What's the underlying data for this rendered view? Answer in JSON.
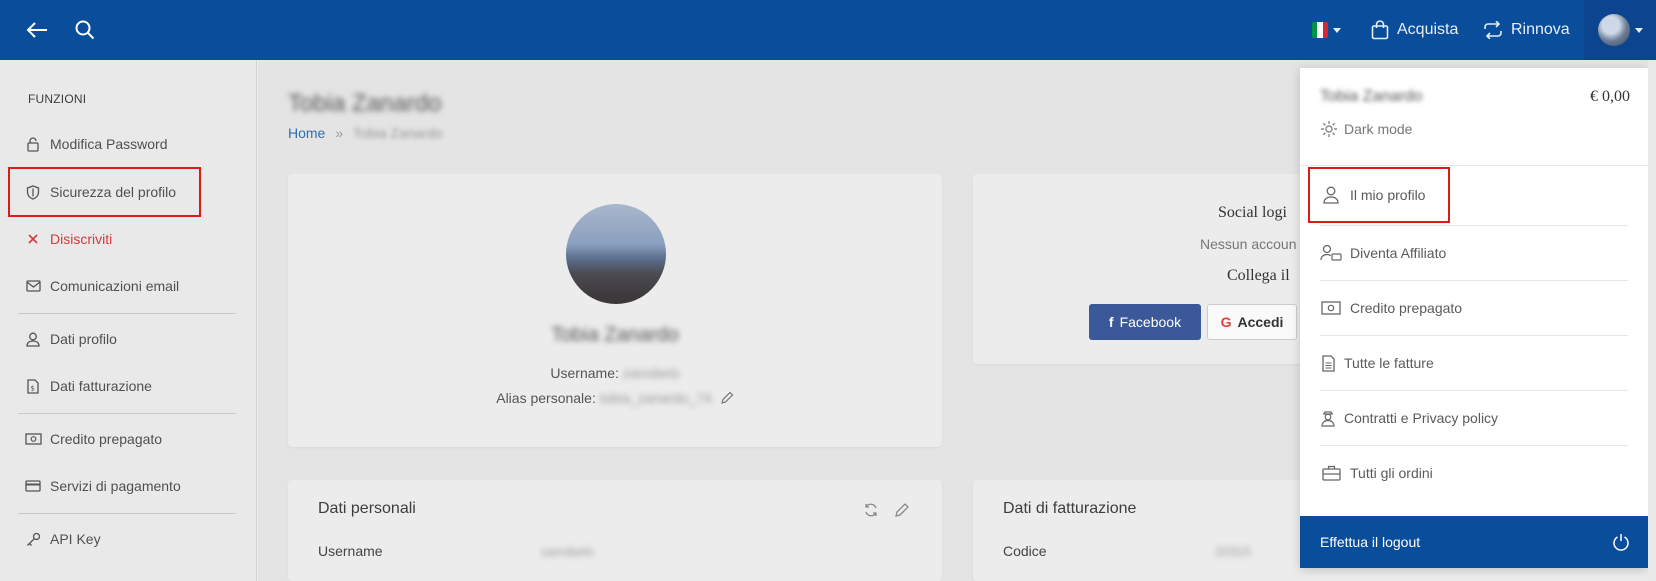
{
  "topbar": {
    "buy_label": "Acquista",
    "renew_label": "Rinnova",
    "flag_colors": [
      "#009246",
      "#ffffff",
      "#ce2b37"
    ]
  },
  "sidebar": {
    "section_title": "FUNZIONI",
    "items": [
      {
        "label": "Modifica Password",
        "icon": "lock-icon"
      },
      {
        "label": "Sicurezza del profilo",
        "icon": "shield-icon"
      },
      {
        "label": "Disiscriviti",
        "icon": "close-icon"
      },
      {
        "label": "Comunicazioni email",
        "icon": "envelope-icon"
      },
      {
        "label": "Dati profilo",
        "icon": "user-icon"
      },
      {
        "label": "Dati fatturazione",
        "icon": "invoice-icon"
      },
      {
        "label": "Credito prepagato",
        "icon": "money-icon"
      },
      {
        "label": "Servizi di pagamento",
        "icon": "credit-card-icon"
      },
      {
        "label": "API Key",
        "icon": "key-icon"
      }
    ]
  },
  "main": {
    "page_title": "Tobia Zanardo",
    "breadcrumb": {
      "home": "Home",
      "sep": "»",
      "current": "Tobia Zanardo"
    },
    "profile_card": {
      "name": "Tobia Zanardo",
      "username_label": "Username:",
      "username_value": "zanobelo",
      "alias_label": "Alias personale:",
      "alias_value": "tobia_zanardo_74"
    },
    "social_card": {
      "title": "Social logi",
      "subtitle": "Nessun accoun",
      "link_title": "Collega il",
      "facebook_label": "Facebook",
      "google_label": "Accedi"
    },
    "personal_card": {
      "title": "Dati personali",
      "username_label": "Username",
      "username_value": "zanobelo"
    },
    "billing_card": {
      "title": "Dati di fatturazione",
      "code_label": "Codice",
      "code_value": "20315"
    }
  },
  "dropdown": {
    "user_name": "Tobia Zanardo",
    "balance": "€ 0,00",
    "dark_mode_label": "Dark mode",
    "items": [
      {
        "label": "Il mio profilo",
        "icon": "user-icon"
      },
      {
        "label": "Diventa Affiliato",
        "icon": "affiliate-icon"
      },
      {
        "label": "Credito prepagato",
        "icon": "money-icon"
      },
      {
        "label": "Tutte le fatture",
        "icon": "document-icon"
      },
      {
        "label": "Contratti e Privacy policy",
        "icon": "agent-icon"
      },
      {
        "label": "Tutti gli ordini",
        "icon": "briefcase-icon"
      }
    ],
    "logout_label": "Effettua il logout"
  },
  "colors": {
    "primary": "#0a4e9b",
    "highlight": "#e01818",
    "danger": "#d53a3a",
    "facebook": "#3b5998"
  }
}
